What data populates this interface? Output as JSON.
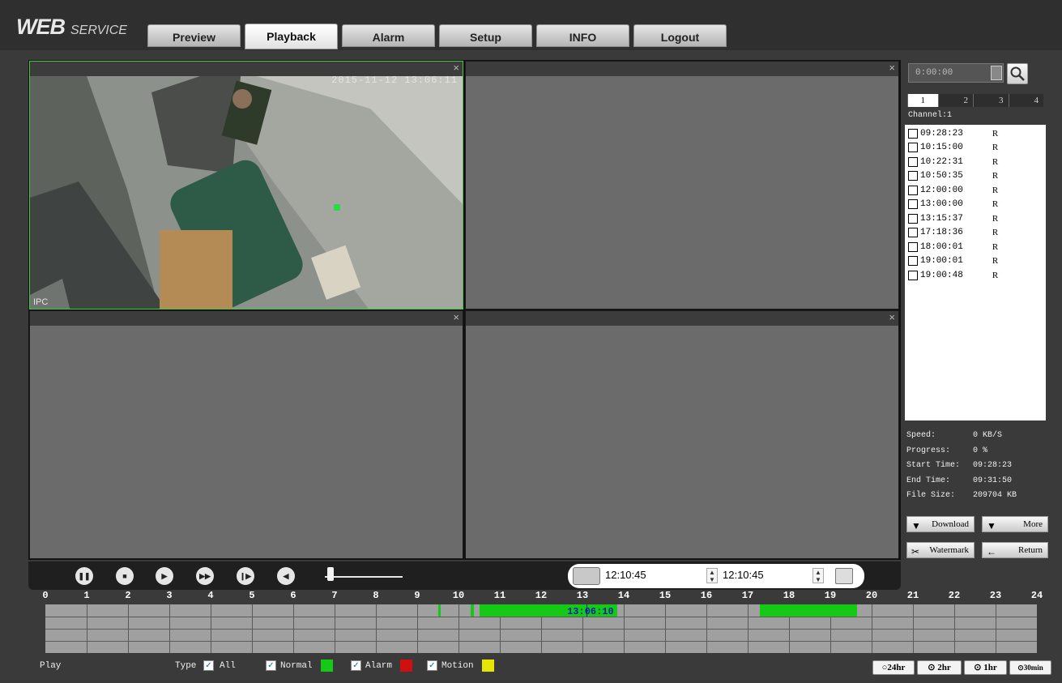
{
  "header": {
    "logo_main": "WEB",
    "logo_sub": "SERVICE",
    "tabs": [
      {
        "label": "Preview"
      },
      {
        "label": "Playback"
      },
      {
        "label": "Alarm"
      },
      {
        "label": "Setup"
      },
      {
        "label": "INFO"
      },
      {
        "label": "Logout"
      }
    ],
    "active_tab": "Playback"
  },
  "video": {
    "pane_1_timestamp": "2015-11-12 13:06:11",
    "pane_1_name": "IPC",
    "close_glyph": "×"
  },
  "right_panel": {
    "time_value": "0:00:00",
    "channel_tabs": [
      "1",
      "2",
      "3",
      "4"
    ],
    "active_channel_tab": "1",
    "channel_label": "Channel:1",
    "files": [
      {
        "time": "09:28:23",
        "type": "R"
      },
      {
        "time": "10:15:00",
        "type": "R"
      },
      {
        "time": "10:22:31",
        "type": "R"
      },
      {
        "time": "10:50:35",
        "type": "R"
      },
      {
        "time": "12:00:00",
        "type": "R"
      },
      {
        "time": "13:00:00",
        "type": "R"
      },
      {
        "time": "13:15:37",
        "type": "R"
      },
      {
        "time": "17:18:36",
        "type": "R"
      },
      {
        "time": "18:00:01",
        "type": "R"
      },
      {
        "time": "19:00:01",
        "type": "R"
      },
      {
        "time": "19:00:48",
        "type": "R"
      }
    ],
    "info": {
      "speed_label": "Speed:",
      "speed_value": "0 KB/S",
      "progress_label": "Progress:",
      "progress_value": "0 %",
      "start_label": "Start Time:",
      "start_value": "09:28:23",
      "end_label": "End Time:",
      "end_value": "09:31:50",
      "size_label": "File Size:",
      "size_value": "209704 KB"
    },
    "buttons": {
      "download": "Download",
      "more": "More",
      "watermark": "Watermark",
      "return": "Return"
    }
  },
  "control_bar": {
    "icons": [
      "pause-icon",
      "stop-icon",
      "slow-play-icon",
      "fast-forward-icon",
      "next-frame-icon",
      "volume-icon"
    ],
    "volume_level": 0.05,
    "range_start": "12:10:45",
    "range_end": "12:10:45"
  },
  "timeline": {
    "hours": [
      "0",
      "1",
      "2",
      "3",
      "4",
      "5",
      "6",
      "7",
      "8",
      "9",
      "10",
      "11",
      "12",
      "13",
      "14",
      "15",
      "16",
      "17",
      "18",
      "19",
      "20",
      "21",
      "22",
      "23",
      "24"
    ],
    "cursor_time": "13:06:10",
    "cursor_hour": 13.1,
    "record_segments": [
      {
        "start": 9.5,
        "end": 9.56
      },
      {
        "start": 10.3,
        "end": 10.37
      },
      {
        "start": 10.5,
        "end": 13.85
      },
      {
        "start": 17.3,
        "end": 19.65
      }
    ],
    "record_color": "#16c916"
  },
  "footer": {
    "status": "Play",
    "type_label": "Type",
    "all_label": "All",
    "normal_label": "Normal",
    "alarm_label": "Alarm",
    "motion_label": "Motion",
    "normal_color": "#16c916",
    "alarm_color": "#d01010",
    "motion_color": "#e6e600",
    "zoom_options": [
      "24hr",
      "2hr",
      "1hr",
      "30min"
    ],
    "selected_zoom": "24hr"
  }
}
